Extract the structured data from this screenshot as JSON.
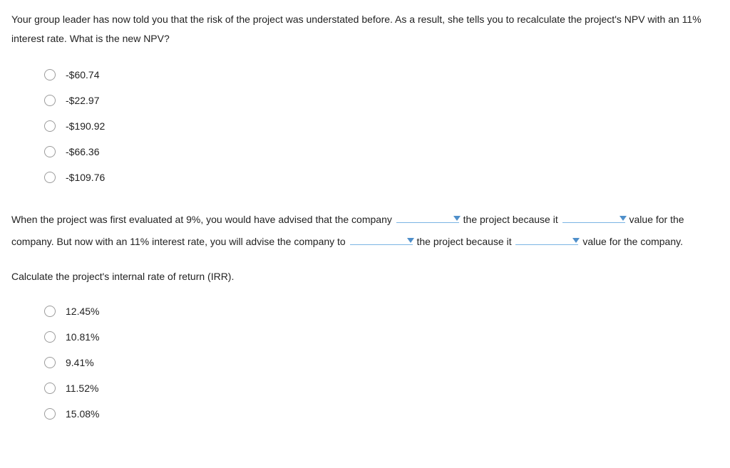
{
  "q1": {
    "prompt": "Your group leader has now told you that the risk of the project was understated before. As a result, she tells you to recalculate the project's NPV with an 11% interest rate. What is the new NPV?",
    "options": [
      "-$60.74",
      "-$22.97",
      "-$190.92",
      "-$66.36",
      "-$109.76"
    ]
  },
  "q2": {
    "t1": "When the project was first evaluated at 9%, you would have advised that the company ",
    "t2": " the project because it ",
    "t3": " value for the company. But now with an 11% interest rate, you will advise the company to ",
    "t4": " the project because it ",
    "t5": " value for the company."
  },
  "q3": {
    "prompt": "Calculate the project's internal rate of return (IRR).",
    "options": [
      "12.45%",
      "10.81%",
      "9.41%",
      "11.52%",
      "15.08%"
    ]
  }
}
